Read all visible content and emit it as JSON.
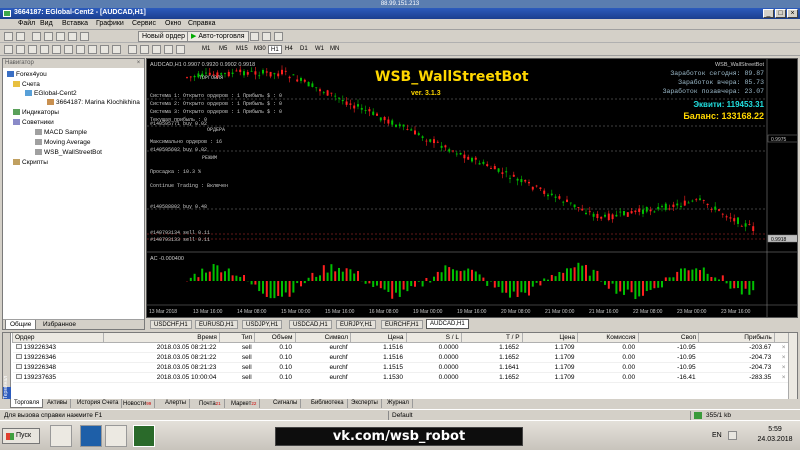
{
  "remote": {
    "title": "88.99.151.213"
  },
  "window": {
    "title": "3664187: EGlobal-Cent2 - [AUDCAD,H1]"
  },
  "menu": [
    "Файл",
    "Вид",
    "Вставка",
    "Графики",
    "Сервис",
    "Окно",
    "Справка"
  ],
  "toolbar": {
    "new_order": "Новый ордер",
    "auto_trading": "Авто-торговля",
    "timeframes": [
      "M1",
      "M5",
      "M15",
      "M30",
      "H1",
      "H4",
      "D1",
      "W1",
      "MN"
    ],
    "active_timeframe": "H1"
  },
  "navigator": {
    "header": "Навигатор",
    "root": "Forex4you",
    "accounts_label": "Счета",
    "server": "EGlobal-Cent2",
    "account": "3664187: Marina Klochikhina",
    "indicators_label": "Индикаторы",
    "advisors_label": "Советники",
    "advisors": [
      "MACD Sample",
      "Moving Average",
      "WSB_WallStreetBot"
    ],
    "scripts_label": "Скрипты",
    "tabs": [
      "Общие",
      "Избранное"
    ]
  },
  "chart": {
    "symbol_info": "AUDCAD,H1  0.9907 0.9920 0.9902 0.9918",
    "bot_label": "WSB_WallStreetBot",
    "bot_title": "WSB_WallStreetBot",
    "bot_version": "ver. 3.1.3",
    "stats": [
      "Заработок сегодня: 89.87",
      "Заработок вчера: 85.73",
      "Заработок позавчера: 23.07"
    ],
    "equity": "Эквити: 119453.31",
    "balance": "Баланс: 133168.22",
    "left_panel": [
      "ТОРГОВЛЯ",
      "Система 1: Открыто ордеров : 1  Прибыль $ : 0",
      "Система 2: Открыто ордеров : 1  Прибыль $ : 0",
      "Система 3: Открыто ордеров : 1  Прибыль $ : 0",
      "Текущая прибыль : 0",
      "ОРДЕРА",
      "Максимально ордеров : 16",
      "РЕЖИМ",
      "Просадка : 10.3 %",
      "Continue Trading : Включен"
    ],
    "order_labels": [
      "#140595771 buy 0.02",
      "#140595602 buy 0.02",
      "#140588802 buy 0.48",
      "#140793134 sell 0.11",
      "#140793133 sell 0.11"
    ],
    "ac_label": "AC -0.000400",
    "price_labels": [
      "0.9975",
      "0.9918"
    ],
    "x_labels": [
      "13 Mar 2018",
      "13 Mar 16:00",
      "14 Mar 08:00",
      "15 Mar 00:00",
      "15 Mar 16:00",
      "16 Mar 08:00",
      "19 Mar 00:00",
      "19 Mar 16:00",
      "20 Mar 08:00",
      "21 Mar 00:00",
      "21 Mar 16:00",
      "22 Mar 08:00",
      "23 Mar 00:00",
      "23 Mar 16:00"
    ],
    "tabs": [
      "USDCHF,H1",
      "EURUSD,H1",
      "USDJPY,H1",
      "USDCAD,H1",
      "EURJPY,H1",
      "EURCHF,H1",
      "AUDCAD,H1"
    ],
    "active_tab": "AUDCAD,H1"
  },
  "terminal": {
    "side_label": "Терминал",
    "columns": [
      "Ордер",
      "Время",
      "Тип",
      "Объем",
      "Символ",
      "Цена",
      "S / L",
      "T / P",
      "Цена",
      "Комиссия",
      "Своп",
      "Прибыль"
    ],
    "rows": [
      [
        "139226343",
        "2018.03.05 08:21:22",
        "sell",
        "0.10",
        "eurchf",
        "1.1516",
        "0.0000",
        "1.1652",
        "1.1709",
        "0.00",
        "-10.95",
        "-203.67"
      ],
      [
        "139226346",
        "2018.03.05 08:21:22",
        "sell",
        "0.10",
        "eurchf",
        "1.1516",
        "0.0000",
        "1.1652",
        "1.1709",
        "0.00",
        "-10.95",
        "-204.73"
      ],
      [
        "139226348",
        "2018.03.05 08:21:23",
        "sell",
        "0.10",
        "eurchf",
        "1.1515",
        "0.0000",
        "1.1641",
        "1.1709",
        "0.00",
        "-10.95",
        "-204.73"
      ],
      [
        "139237635",
        "2018.03.05 10:00:04",
        "sell",
        "0.10",
        "eurchf",
        "1.1530",
        "0.0000",
        "1.1652",
        "1.1709",
        "0.00",
        "-16.41",
        "-283.35"
      ]
    ],
    "tabs": [
      {
        "label": "Торговля",
        "num": ""
      },
      {
        "label": "Активы",
        "num": ""
      },
      {
        "label": "История Счета",
        "num": ""
      },
      {
        "label": "Новости",
        "num": "99"
      },
      {
        "label": "Алерты",
        "num": ""
      },
      {
        "label": "Почта",
        "num": "21"
      },
      {
        "label": "Маркет",
        "num": "22"
      },
      {
        "label": "Сигналы",
        "num": ""
      },
      {
        "label": "Библиотека",
        "num": ""
      },
      {
        "label": "Эксперты",
        "num": ""
      },
      {
        "label": "Журнал",
        "num": ""
      }
    ]
  },
  "statusbar": {
    "help": "Для вызова справки нажмите F1",
    "profile": "Default",
    "traffic": "355/1 kb"
  },
  "taskbar": {
    "start": "Пуск",
    "banner": "vk.com/wsb_robot",
    "lang": "EN",
    "time": "5:59",
    "date": "24.03.2018"
  },
  "colors": {
    "bull": "#00c000",
    "bear": "#ff2020",
    "chart_bg": "#000000",
    "gold": "#ffd700",
    "cyan": "#22e0e0"
  }
}
